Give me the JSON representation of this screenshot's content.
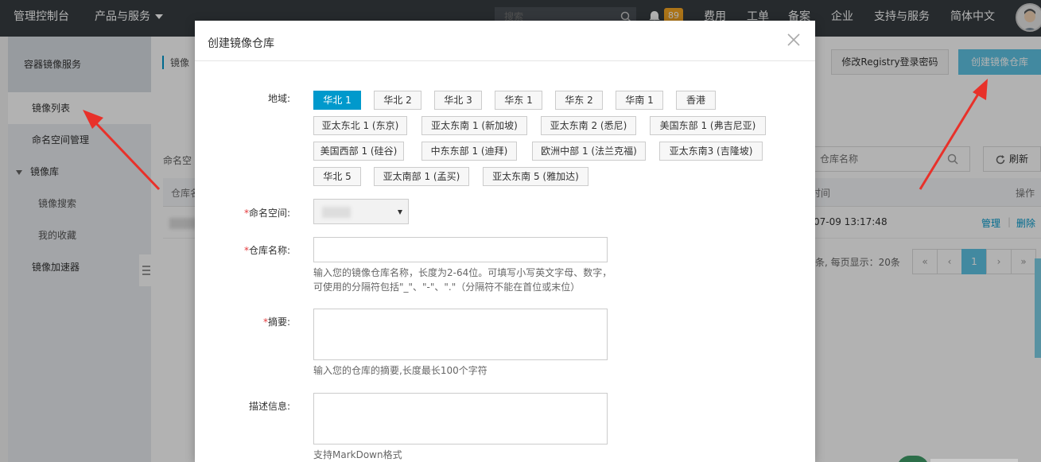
{
  "topnav": {
    "brand": "管理控制台",
    "products": "产品与服务",
    "search_placeholder": "搜索",
    "notification_count": "89",
    "links": [
      "费用",
      "工单",
      "备案",
      "企业",
      "支持与服务",
      "简体中文"
    ]
  },
  "sidebar": {
    "title": "容器镜像服务",
    "items": [
      {
        "label": "镜像列表",
        "active": true
      },
      {
        "label": "命名空间管理"
      },
      {
        "label": "镜像库"
      },
      {
        "label": "镜像搜索"
      },
      {
        "label": "我的收藏"
      },
      {
        "label": "镜像加速器"
      }
    ]
  },
  "main": {
    "breadcrumb": "镜像",
    "btn_change_pwd": "修改Registry登录密码",
    "btn_create": "创建镜像仓库",
    "namespace_label": "命名空",
    "repo_search_placeholder": "仓库名称",
    "btn_refresh": "刷新",
    "table": {
      "col_first": "仓库名",
      "col_time": "时间",
      "col_ops": "操作",
      "row": {
        "time": "07-09 13:17:48",
        "manage": "管理",
        "delete": "删除",
        "sep": "|"
      }
    },
    "pager_info": "条, 每页显示：20条",
    "pager": [
      "«",
      "‹",
      "1",
      "›",
      "»"
    ]
  },
  "modal": {
    "title": "创建镜像仓库",
    "region_label": "地域:",
    "regions": [
      "华北 1",
      "华北 2",
      "华北 3",
      "华东 1",
      "华东 2",
      "华南 1",
      "香港",
      "亚太东北 1 (东京)",
      "亚太东南 1 (新加坡)",
      "亚太东南 2 (悉尼)",
      "美国东部 1 (弗吉尼亚)",
      "美国西部 1 (硅谷)",
      "中东东部 1 (迪拜)",
      "欧洲中部 1 (法兰克福)",
      "亚太东南3 (吉隆坡)",
      "华北 5",
      "亚太南部 1 (孟买)",
      "亚太东南 5 (雅加达)"
    ],
    "selected_region": "华北 1",
    "namespace_label": "命名空间:",
    "repo_name_label": "仓库名称:",
    "repo_name_hint": "输入您的镜像仓库名称，长度为2-64位。可填写小写英文字母、数字，可使用的分隔符包括\"_\"、\"-\"、\".\"（分隔符不能在首位或末位）",
    "summary_label": "摘要:",
    "summary_hint": "输入您的仓库的摘要,长度最长100个字符",
    "desc_label": "描述信息:",
    "desc_hint": "支持MarkDown格式",
    "required_mark": "*"
  }
}
